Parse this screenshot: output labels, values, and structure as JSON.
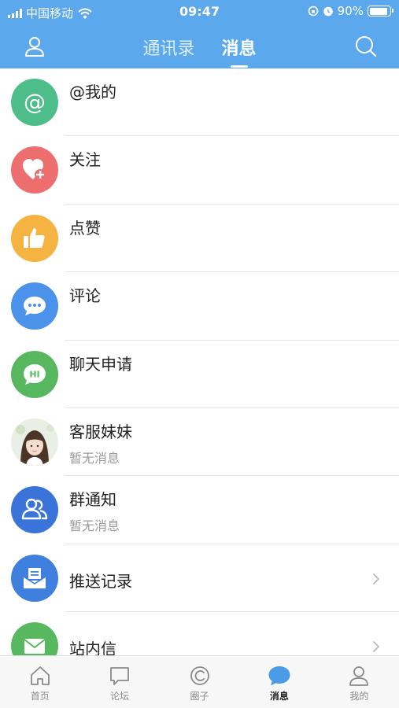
{
  "status_bar": {
    "carrier": "中国移动",
    "time": "09:47",
    "battery": "90%",
    "battery_level": 0.9
  },
  "header": {
    "tabs": [
      {
        "label": "通讯录",
        "active": false
      },
      {
        "label": "消息",
        "active": true
      }
    ],
    "left_icon": "user-icon",
    "right_icon": "search-icon"
  },
  "list": {
    "items": [
      {
        "title": "@我的",
        "icon": "at-icon",
        "color": "#4dbd8a"
      },
      {
        "title": "关注",
        "icon": "heart-plus-icon",
        "color": "#ec6e6e"
      },
      {
        "title": "点赞",
        "icon": "thumbs-up-icon",
        "color": "#f5b342"
      },
      {
        "title": "评论",
        "icon": "comment-icon",
        "color": "#4b93ea"
      },
      {
        "title": "聊天申请",
        "icon": "hi-bubble-icon",
        "color": "#58b85f"
      },
      {
        "title": "客服妹妹",
        "subtitle": "暂无消息",
        "icon": "avatar-photo"
      },
      {
        "title": "群通知",
        "subtitle": "暂无消息",
        "icon": "group-icon",
        "color": "#3a74d8"
      },
      {
        "title": "推送记录",
        "icon": "inbox-icon",
        "color": "#3f80de",
        "chevron": true
      },
      {
        "title": "站内信",
        "icon": "mail-icon",
        "color": "#58b85f",
        "chevron": true
      }
    ]
  },
  "tabbar": {
    "items": [
      {
        "label": "首页",
        "icon": "home-icon",
        "active": false
      },
      {
        "label": "论坛",
        "icon": "forum-icon",
        "active": false
      },
      {
        "label": "圈子",
        "icon": "circle-icon",
        "active": false
      },
      {
        "label": "消息",
        "icon": "message-icon",
        "active": true
      },
      {
        "label": "我的",
        "icon": "profile-icon",
        "active": false
      }
    ]
  },
  "colors": {
    "header_bg": "#5ba8ec",
    "tab_active": "#4b9be6",
    "tab_inactive": "#8a8a8a"
  }
}
